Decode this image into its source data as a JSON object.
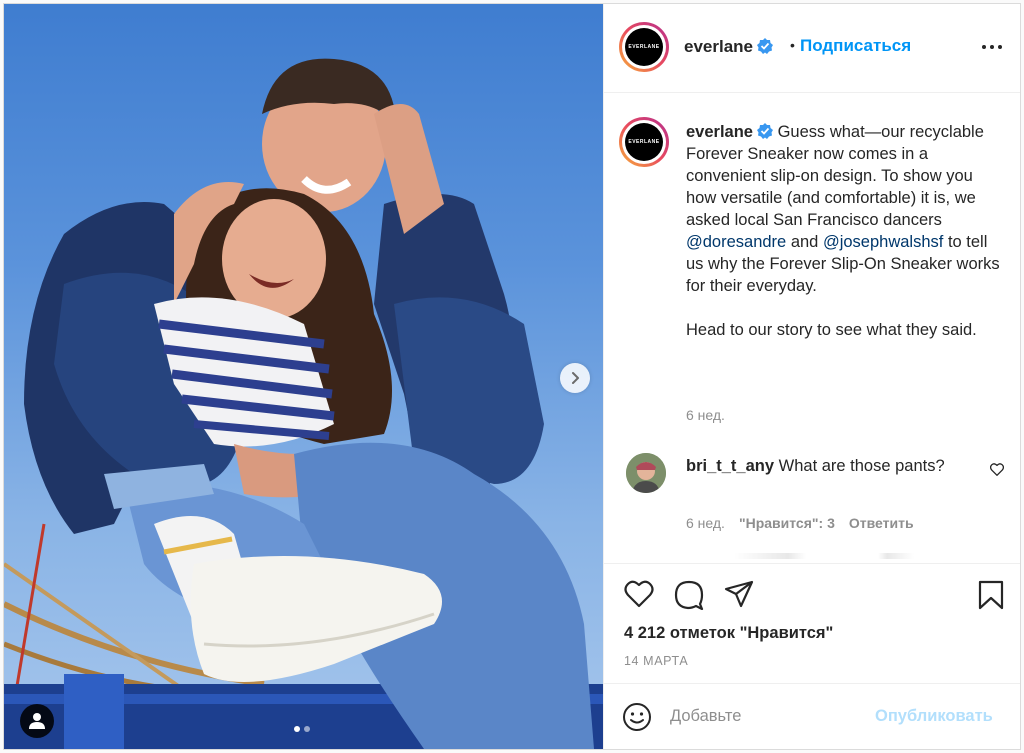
{
  "colors": {
    "link": "#0095f6",
    "mention": "#00376b",
    "muted": "#8e8e8e",
    "publish_disabled": "#b2dffc",
    "verified": "#3897f0"
  },
  "account": {
    "username": "everlane",
    "logo_text": "EVERLANE",
    "verified_icon": "verified-badge-icon"
  },
  "header": {
    "separator": "•",
    "follow_label": "Подписаться",
    "more_icon": "more-horizontal-icon"
  },
  "media": {
    "carousel_total": 2,
    "carousel_active": 0,
    "next_icon": "chevron-right-icon",
    "tag_icon": "user-icon"
  },
  "caption": {
    "text_1": "Guess what—our recyclable Forever Sneaker now comes in a convenient slip-on design. To show you how versatile (and comfortable) it is, we asked local San Francisco dancers",
    "mention_1": "@doresandre",
    "text_2": "and",
    "mention_2": "@josephwalshsf",
    "text_3": "to tell us why the Forever Slip-On Sneaker works for their everyday.",
    "paragraph_2": "Head to our story to see what they said.",
    "time": "6 нед."
  },
  "comment": {
    "username": "bri_t_t_any",
    "text": "What are those pants?",
    "time": "6 нед.",
    "likes_label": "\"Нравится\": 3",
    "reply_label": "Ответить",
    "like_icon": "heart-outline-icon"
  },
  "actions": {
    "like_icon": "heart-icon",
    "comment_icon": "comment-icon",
    "share_icon": "paper-plane-icon",
    "save_icon": "bookmark-icon",
    "likes_count": "4 212 отметок \"Нравится\"",
    "date": "14 МАРТА"
  },
  "add_comment": {
    "emoji_icon": "emoji-smile-icon",
    "placeholder": "Добавьте",
    "publish_label": "Опубликовать"
  }
}
